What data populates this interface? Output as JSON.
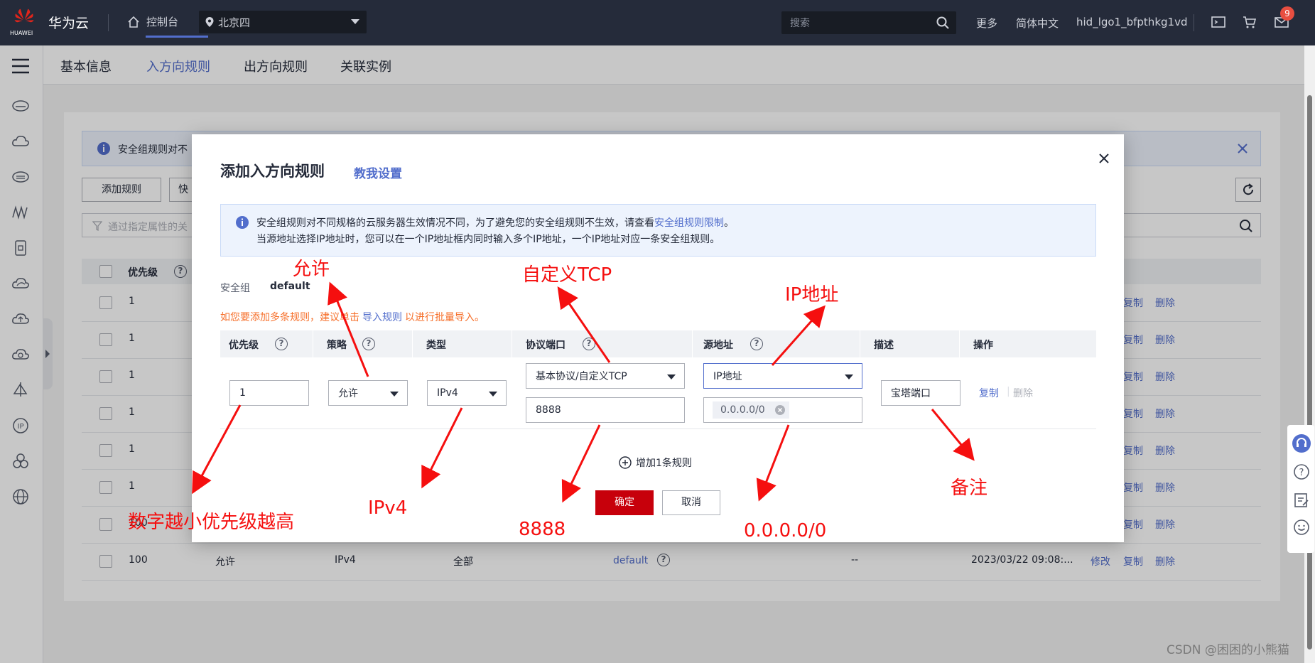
{
  "topbar": {
    "logo_text": "HUAWEI",
    "brand": "华为云",
    "console": "控制台",
    "region": "北京四",
    "search_placeholder": "搜索",
    "more": "更多",
    "language": "简体中文",
    "username": "hid_lgo1_bfpthkg1vd",
    "badge_count": "9"
  },
  "tabs": [
    "基本信息",
    "入方向规则",
    "出方向规则",
    "关联实例"
  ],
  "background": {
    "alert_text": "安全组规则对不",
    "add_rule_button": "添加规则",
    "second_button": "快",
    "filter_placeholder": "通过指定属性的关",
    "priority_header": "优先级",
    "rows": [
      {
        "priority": "1",
        "actions": [
          "复制",
          "删除"
        ]
      },
      {
        "priority": "1",
        "actions": [
          "复制",
          "删除"
        ]
      },
      {
        "priority": "1",
        "actions": [
          "复制",
          "删除"
        ]
      },
      {
        "priority": "1",
        "actions": [
          "复制",
          "删除"
        ]
      },
      {
        "priority": "1",
        "actions": [
          "复制",
          "删除"
        ]
      },
      {
        "priority": "1",
        "actions": [
          "复制",
          "删除"
        ]
      },
      {
        "priority": "100",
        "actions": [
          "复制",
          "删除"
        ]
      }
    ],
    "last_row": {
      "priority": "100",
      "policy": "允许",
      "type": "IPv4",
      "port": "全部",
      "source": "default",
      "desc": "--",
      "time": "2023/03/22 09:08:...",
      "actions": [
        "修改",
        "复制",
        "删除"
      ]
    }
  },
  "modal": {
    "title": "添加入方向规则",
    "help_link": "教我设置",
    "info_line1_pre": "安全组规则对不同规格的云服务器生效情况不同，为了避免您的安全组规则不生效，请查看",
    "info_line1_link": "安全组规则限制",
    "info_line1_post": "。",
    "info_line2": "当源地址选择IP地址时，您可以在一个IP地址框内同时输入多个IP地址，一个IP地址对应一条安全组规则。",
    "sg_label": "安全组",
    "sg_value": "default",
    "tip_pre": "如您要添加多条规则，建议单击",
    "tip_link": "导入规则",
    "tip_post": "以进行批量导入。",
    "columns": [
      "优先级",
      "策略",
      "类型",
      "协议端口",
      "源地址",
      "描述",
      "操作"
    ],
    "row": {
      "priority": "1",
      "policy": "允许",
      "type": "IPv4",
      "protocol": "基本协议/自定义TCP",
      "port": "8888",
      "source_type": "IP地址",
      "source_ip": "0.0.0.0/0",
      "description": "宝塔端口",
      "copy": "复制",
      "delete": "删除"
    },
    "add_rule": "增加1条规则",
    "ok": "确定",
    "cancel": "取消"
  },
  "annotations": {
    "allow": "允许",
    "custom_tcp": "自定义TCP",
    "ip_address": "IP地址",
    "priority_note": "数字越小优先级越高",
    "ipv4": "IPv4",
    "port": "8888",
    "any_ip": "0.0.0.0/0",
    "remark": "备注"
  },
  "watermark": "CSDN @困困的小熊猫",
  "colors": {
    "topbar": "#252b3a",
    "accent": "#526ecc",
    "primary_button": "#c7000b",
    "annotation": "#f50f0f",
    "tip": "#f66f2a"
  }
}
